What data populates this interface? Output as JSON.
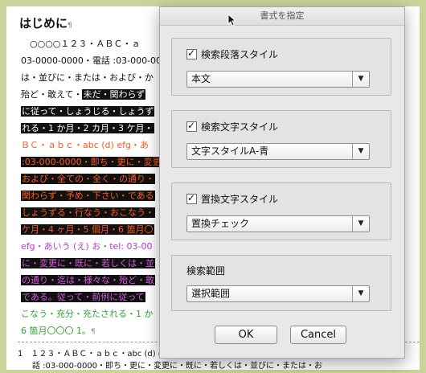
{
  "document": {
    "heading": "はじめに",
    "heading_mark": "¶",
    "lines": [
      "　○○○○１２３・ＡＢＣ・ａ",
      "03-0000-0000・電話 :03-000-000",
      "は・並びに・または・および・か",
      "殆ど・敢えて・",
      "に従って・しょうじる・しょうず",
      "れる・1 か月・2 カ月・3 ケ月・",
      "ＢＣ・ａｂｃ・abc (d) efg・あ",
      ":03-000-0000・即ち・更に・変更",
      "および・全ての・全く・の通り・",
      "関わらず・予め・下さい・である",
      "しょうずる・行なう・おこなう・",
      "ケ月・4 ヶ月・5 個月・6 箇月〇",
      "efg・あいう (え) お・tel: 03-00",
      "に・変更に・既に・若しくは・並",
      "の通り・迄は・様々な・殆ど・敢",
      "である。従って・前例に従って",
      "こなう・充分・充たされる・1 か",
      "6 箇月〇〇〇 1。"
    ],
    "line3_highlight": "未だ・関わらず",
    "end_mark": "¶",
    "footer_line1": "1　１２３・ＡＢＣ・ａｂｃ・abc (d) efg・あいう (え) お・tel: 03-000-0000・電",
    "footer_line2": "話 :03-000-0000・即ち・更に・変更に・既に・若しくは・並びに・または・お"
  },
  "dialog": {
    "title": "書式を指定",
    "find_para": {
      "checked": true,
      "label": "検索段落スタイル",
      "value": "本文"
    },
    "find_char": {
      "checked": true,
      "label": "検索文字スタイル",
      "value": "文字スタイルA-青"
    },
    "replace_char": {
      "checked": true,
      "label": "置換文字スタイル",
      "value": "置換チェック"
    },
    "scope": {
      "label": "検索範囲",
      "value": "選択範囲"
    },
    "ok_label": "OK",
    "cancel_label": "Cancel",
    "check_glyph": "✓",
    "arrow_glyph": "▼"
  },
  "colors": {
    "page_background": "#c9d39a",
    "highlight_orange": "#ff5a1e",
    "highlight_purple": "#d65be0",
    "green_text": "#37a03a"
  }
}
